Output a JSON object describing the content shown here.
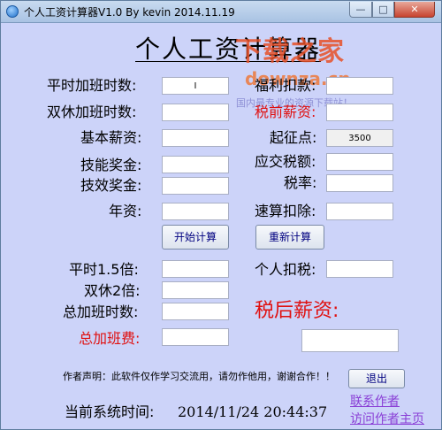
{
  "window": {
    "title": "个人工资计算器V1.0 By kevin 2014.11.19",
    "min_glyph": "—",
    "max_glyph": "□",
    "close_glyph": "✕"
  },
  "app_title": "个人工资计算器",
  "watermark": {
    "brand": "下载之家",
    "domain": "downza.cn",
    "slogan": "国内最专业的资源下载站！"
  },
  "left_labels": {
    "weekday_ot_hours": "平时加班时数:",
    "weekend_ot_hours": "双休加班时数:",
    "base_salary": "基本薪资:",
    "skill_bonus": "技能奖金:",
    "performance_bonus": "技效奖金:",
    "seniority_pay": "年资:"
  },
  "right_labels": {
    "benefit_deduction": "福利扣款:",
    "pretax_salary": "税前薪资:",
    "threshold": "起征点:",
    "taxable_amount": "应交税额:",
    "tax_rate": "税率:",
    "quick_deduction": "速算扣除:"
  },
  "threshold_value": "3500",
  "weekday_ot_value": "I",
  "buttons": {
    "calculate": "开始计算",
    "reset": "重新计算",
    "exit": "退出"
  },
  "result_labels": {
    "weekday_ot_15x": "平时1.5倍:",
    "weekend_ot_2x": "双休2倍:",
    "total_ot_hours": "总加班时数:",
    "total_ot_pay": "总加班费:",
    "personal_tax": "个人扣税:",
    "aftertax_salary": "税后薪资:"
  },
  "disclaimer": "作者声明：此软件仅作学习交流用，请勿作他用，谢谢合作！！",
  "links": {
    "contact": "联系作者",
    "homepage": "访问作者主页"
  },
  "status": {
    "label": "当前系统时间:",
    "datetime": "2014/11/24 20:44:37"
  },
  "colors": {
    "window_bg": "#ccd3f9",
    "highlight_red": "#e01010",
    "link": "#8a3fd6"
  }
}
